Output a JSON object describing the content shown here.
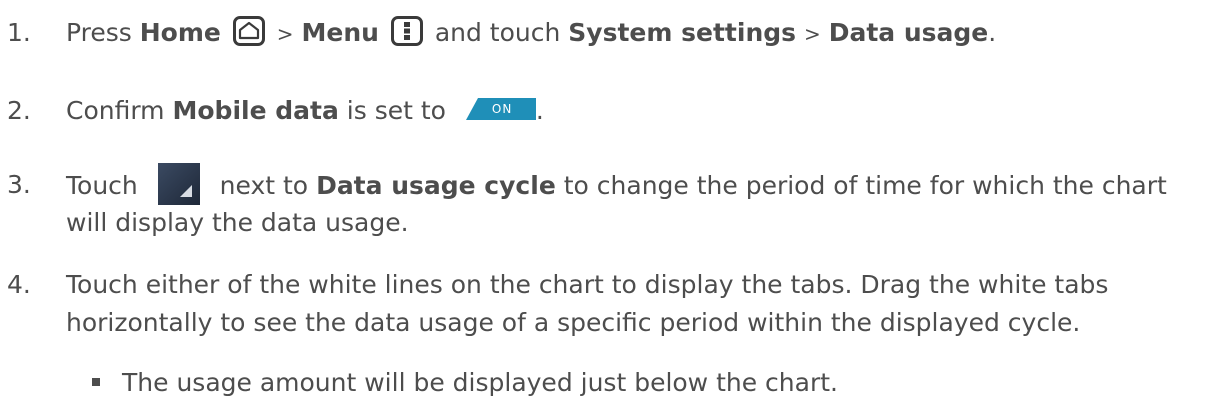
{
  "steps": [
    {
      "num": "1.",
      "press": "Press",
      "home": "Home",
      "sep1": ">",
      "menu": "Menu",
      "and_touch": "and touch",
      "system_settings": "System settings",
      "sep2": ">",
      "data_usage": "Data usage",
      "end": "."
    },
    {
      "num": "2.",
      "confirm": "Confirm",
      "mobile_data": "Mobile data",
      "is_set_to": "is set to",
      "toggle_label": "ON",
      "end": "."
    },
    {
      "num": "3.",
      "touch": "Touch",
      "next_to": "next to",
      "cycle": "Data usage cycle",
      "rest1": "to change the period of time for which the chart",
      "rest2": "will display the data usage."
    },
    {
      "num": "4.",
      "line1": "Touch either of the white lines on the chart to display the tabs. Drag the white tabs",
      "line2": "horizontally to see the data usage of a specific period within the displayed cycle."
    }
  ],
  "bullet": "The usage amount will be displayed just below the chart.",
  "icons": {
    "home": "home-key-icon",
    "menu": "menu-key-icon",
    "toggle": "on-toggle-icon",
    "spinner": "dropdown-spinner-icon"
  },
  "colors": {
    "text": "#4d4d4d",
    "toggle": "#1f8fb8",
    "spinner_bg": "#2c3a4f"
  }
}
